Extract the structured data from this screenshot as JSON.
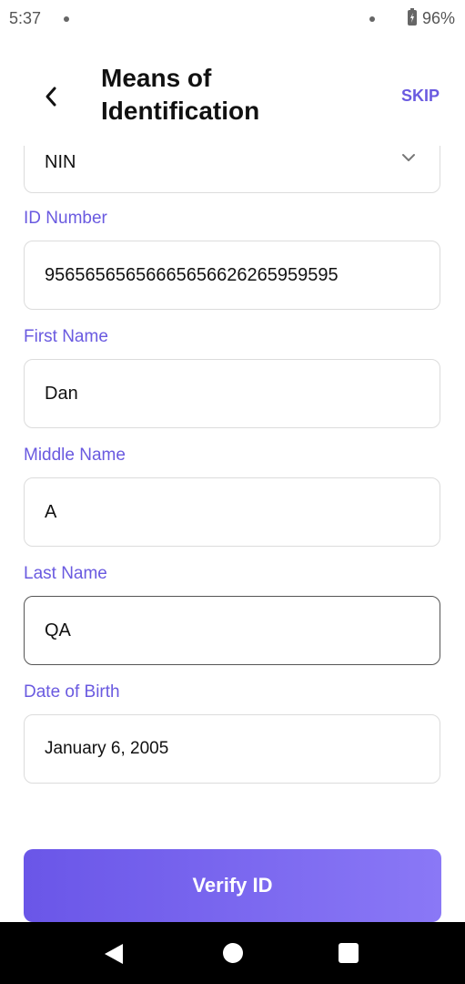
{
  "status_bar": {
    "time": "5:37",
    "battery": "96%"
  },
  "header": {
    "title_line1": "Means of",
    "title_line2": "Identification",
    "skip": "SKIP"
  },
  "form": {
    "id_type": "NIN",
    "id_number_label": "ID Number",
    "id_number_value": "956565656566656566262659595​95",
    "first_name_label": "First Name",
    "first_name_value": "Dan",
    "middle_name_label": "Middle Name",
    "middle_name_value": "A",
    "last_name_label": "Last Name",
    "last_name_value": "QA",
    "dob_label": "Date of Birth",
    "dob_value": "January 6, 2005"
  },
  "actions": {
    "verify": "Verify ID"
  },
  "colors": {
    "accent": "#6a5ae0",
    "button_start": "#6a56e8",
    "button_end": "#8a78f6"
  }
}
